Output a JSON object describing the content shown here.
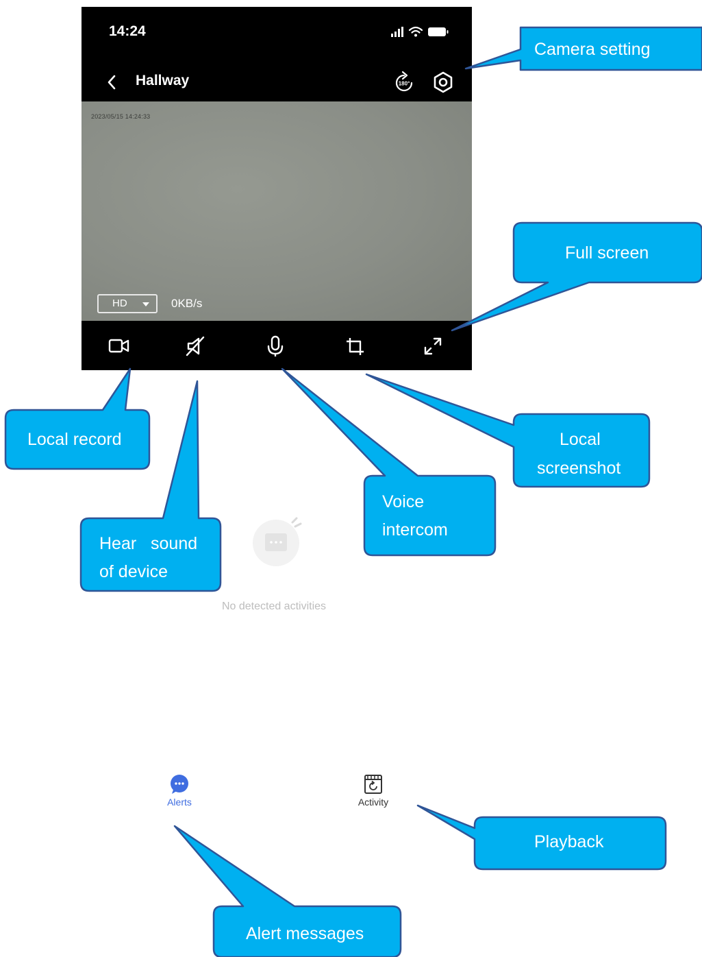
{
  "status": {
    "time": "14:24"
  },
  "nav": {
    "title": "Hallway"
  },
  "video": {
    "timestamp": "2023/05/15 14:24:33",
    "quality": "HD",
    "bitrate": "0KB/s"
  },
  "empty_state": {
    "text": "No detected activities"
  },
  "tabs": {
    "alerts": "Alerts",
    "activity": "Activity"
  },
  "rotate_badge": "180°",
  "callouts": {
    "camera_setting": "Camera setting",
    "full_screen": "Full screen",
    "local_record": "Local record",
    "local_screenshot_1": "Local",
    "local_screenshot_2": "screenshot",
    "voice_intercom_1": "Voice",
    "voice_intercom_2": "intercom",
    "hear_sound_1": "Hear   sound",
    "hear_sound_2": "of device",
    "playback": "Playback",
    "alert_messages": "Alert messages"
  },
  "colors": {
    "callout_fill": "#00b0f0",
    "callout_stroke": "#2f5597",
    "alert_tab": "#3f6de0"
  }
}
